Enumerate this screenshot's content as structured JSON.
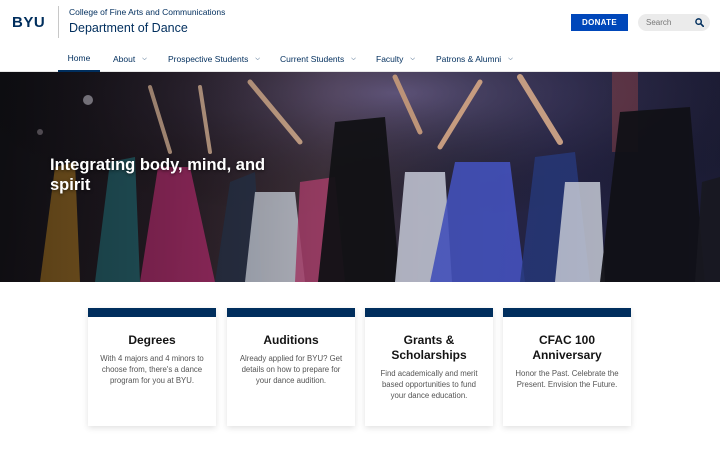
{
  "header": {
    "logo": "BYU",
    "college": "College of Fine Arts and Communications",
    "department": "Department of Dance",
    "donate_label": "DONATE",
    "search_placeholder": "Search",
    "search_icon": "magnifier-icon"
  },
  "nav": {
    "items": [
      {
        "label": "Home",
        "active": true
      },
      {
        "label": "About",
        "dropdown": true
      },
      {
        "label": "Prospective Students",
        "dropdown": true
      },
      {
        "label": "Current Students",
        "dropdown": true
      },
      {
        "label": "Faculty",
        "dropdown": true
      },
      {
        "label": "Patrons & Alumni",
        "dropdown": true
      }
    ]
  },
  "hero": {
    "title": "Integrating body, mind, and spirit"
  },
  "cards": [
    {
      "title": "Degrees",
      "text": "With 4 majors and 4 minors to choose from, there's a dance program for you at BYU."
    },
    {
      "title": "Auditions",
      "text": "Already applied for BYU? Get details on how to prepare for your dance audition."
    },
    {
      "title": "Grants & Scholarships",
      "text": "Find academically and merit based opportunities to fund your dance education."
    },
    {
      "title": "CFAC 100 Anniversary",
      "text": "Honor the Past. Celebrate the Present. Envision the Future."
    }
  ],
  "colors": {
    "navy": "#002e5d",
    "royal": "#0047ba"
  }
}
